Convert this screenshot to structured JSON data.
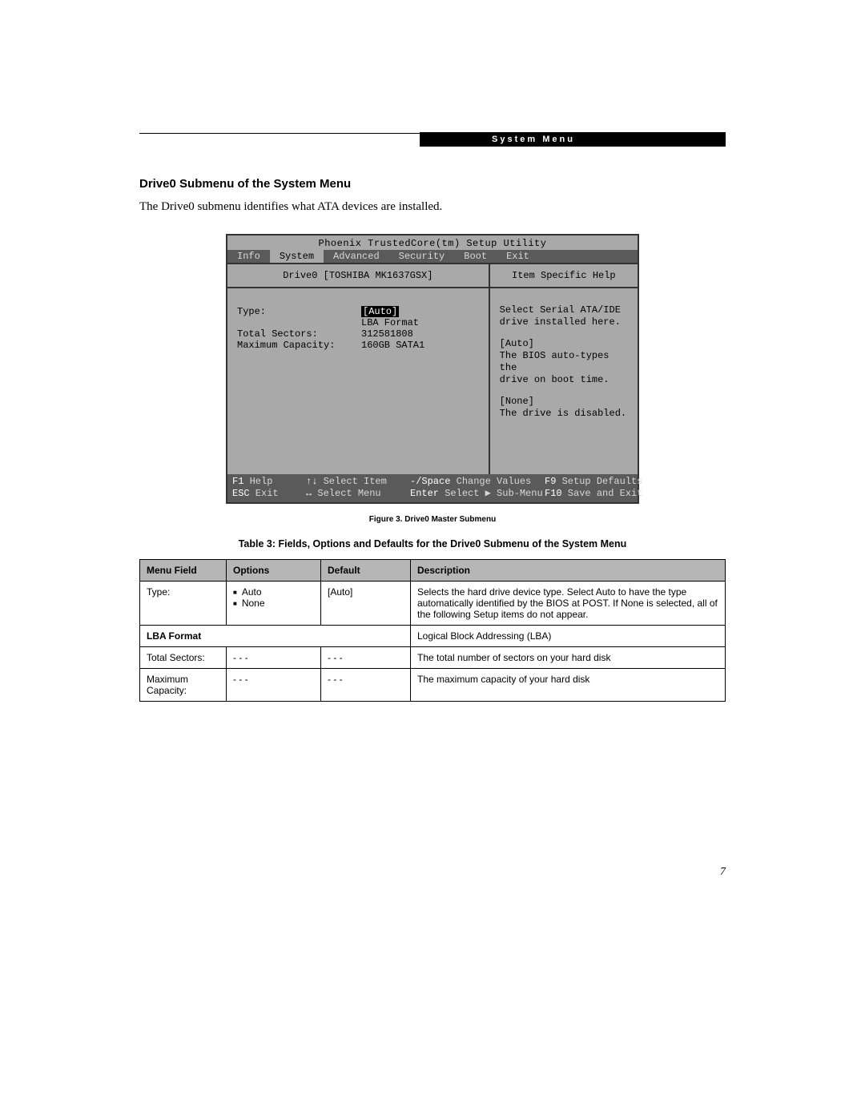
{
  "header": {
    "label": "System Menu"
  },
  "section": {
    "title": "Drive0 Submenu of the System Menu",
    "intro": "The Drive0 submenu identifies what ATA devices are installed."
  },
  "bios": {
    "title": "Phoenix TrustedCore(tm) Setup Utility",
    "menubar": [
      "Info",
      "System",
      "Advanced",
      "Security",
      "Boot",
      "Exit"
    ],
    "selected_tab": "System",
    "left_heading": "Drive0 [TOSHIBA MK1637GSX]",
    "right_heading": "Item Specific Help",
    "fields": {
      "type_label": "Type:",
      "type_value": "[Auto]",
      "lba_label": "LBA Format",
      "sectors_label": "Total Sectors:",
      "sectors_value": "312581808",
      "capacity_label": "Maximum Capacity:",
      "capacity_value": "160GB SATA1"
    },
    "help": {
      "b1": "Select Serial ATA/IDE\ndrive installed here.",
      "b2": "[Auto]\nThe BIOS auto-types the\ndrive on boot time.",
      "b3": "[None]\nThe drive is disabled."
    },
    "footer": {
      "r1c1k": "F1",
      "r1c1t": " Help",
      "r1c2k": "↑↓",
      "r1c2t": " Select Item",
      "r1c3k": "-/Space",
      "r1c3t": " Change Values",
      "r1c4k": "F9",
      "r1c4t": " Setup Defaults",
      "r2c1k": "ESC",
      "r2c1t": " Exit",
      "r2c2k": "↔",
      "r2c2t": " Select Menu",
      "r2c3k": "Enter",
      "r2c3t": " Select ▶ Sub-Menu",
      "r2c4k": "F10",
      "r2c4t": " Save and Exit"
    }
  },
  "figure_caption": "Figure 3.  Drive0 Master Submenu",
  "table_caption": "Table 3: Fields, Options and Defaults for the Drive0 Submenu of the System Menu",
  "table": {
    "headers": [
      "Menu Field",
      "Options",
      "Default",
      "Description"
    ],
    "rows": [
      {
        "field": "Type:",
        "options": [
          "Auto",
          "None"
        ],
        "default": "[Auto]",
        "desc": "Selects the hard drive device type. Select Auto to have the type automatically identified by the BIOS at POST. If None is selected, all of the following Setup items do not appear."
      }
    ],
    "subhead": {
      "label": "LBA Format",
      "desc": "Logical Block Addressing (LBA)"
    },
    "rows2": [
      {
        "field": "Total Sectors:",
        "options_text": "- - -",
        "default": "- - -",
        "desc": "The total number of sectors on your hard disk"
      },
      {
        "field": "Maximum Capacity:",
        "options_text": "- - -",
        "default": "- - -",
        "desc": "The maximum capacity of your hard disk"
      }
    ]
  },
  "page_number": "7"
}
